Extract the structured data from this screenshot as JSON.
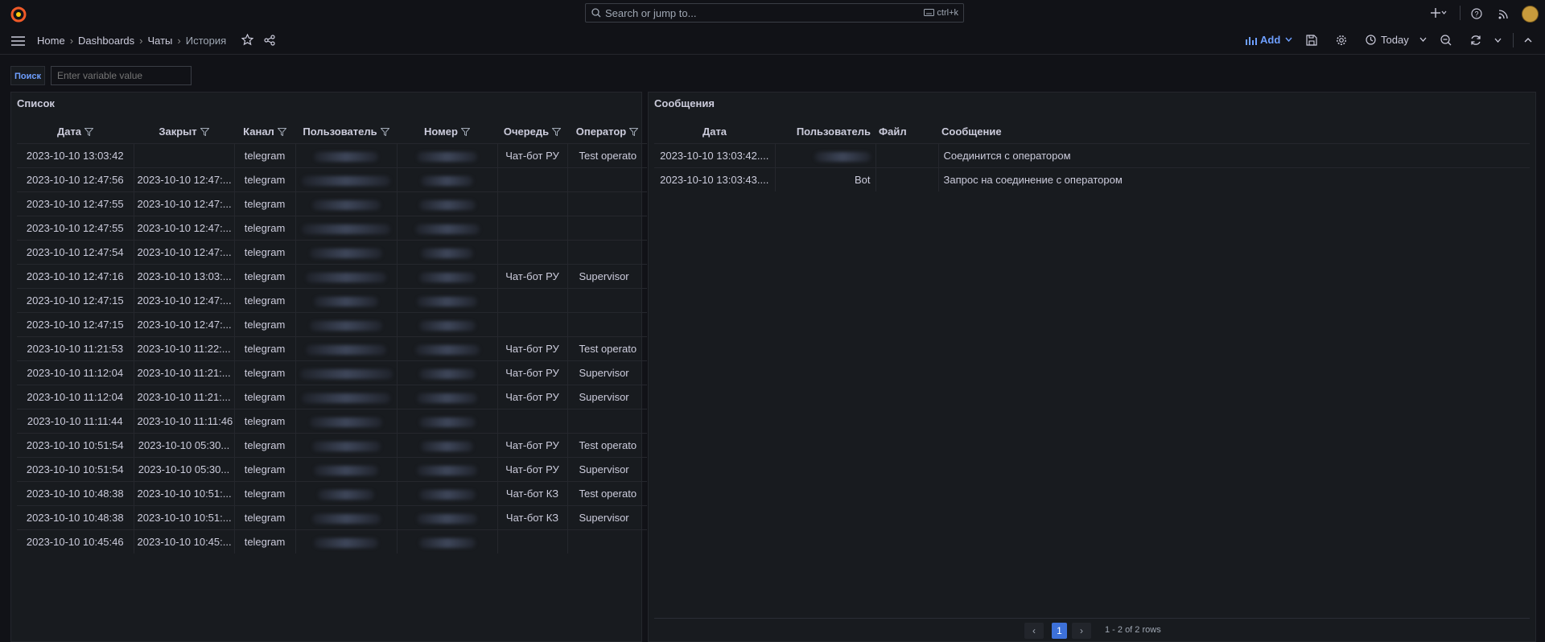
{
  "colors": {
    "accent": "#6e9fff",
    "background": "#111217",
    "panel": "#181b1f",
    "logo": "#f05a28"
  },
  "search": {
    "placeholder": "Search or jump to...",
    "shortcut": "ctrl+k"
  },
  "breadcrumb": {
    "home": "Home",
    "dashboards": "Dashboards",
    "folder": "Чаты",
    "current": "История"
  },
  "toolbar": {
    "add_label": "Add",
    "time_range": "Today"
  },
  "variable": {
    "label": "Поиск",
    "placeholder": "Enter variable value"
  },
  "left_panel": {
    "title": "Список",
    "columns": [
      "Дата",
      "Закрыт",
      "Канал",
      "Пользователь",
      "Номер",
      "Очередь",
      "Оператор"
    ],
    "rows": [
      [
        "2023-10-10 13:03:42",
        "",
        "telegram",
        "",
        "",
        "Чат-бот РУ",
        "Test operato"
      ],
      [
        "2023-10-10 12:47:56",
        "2023-10-10 12:47:...",
        "telegram",
        "",
        "",
        "",
        ""
      ],
      [
        "2023-10-10 12:47:55",
        "2023-10-10 12:47:...",
        "telegram",
        "",
        "",
        "",
        ""
      ],
      [
        "2023-10-10 12:47:55",
        "2023-10-10 12:47:...",
        "telegram",
        "",
        "",
        "",
        ""
      ],
      [
        "2023-10-10 12:47:54",
        "2023-10-10 12:47:...",
        "telegram",
        "",
        "",
        "",
        ""
      ],
      [
        "2023-10-10 12:47:16",
        "2023-10-10 13:03:...",
        "telegram",
        "",
        "",
        "Чат-бот РУ",
        "Supervisor"
      ],
      [
        "2023-10-10 12:47:15",
        "2023-10-10 12:47:...",
        "telegram",
        "",
        "",
        "",
        ""
      ],
      [
        "2023-10-10 12:47:15",
        "2023-10-10 12:47:...",
        "telegram",
        "",
        "",
        "",
        ""
      ],
      [
        "2023-10-10 11:21:53",
        "2023-10-10 11:22:...",
        "telegram",
        "",
        "",
        "Чат-бот РУ",
        "Test operato"
      ],
      [
        "2023-10-10 11:12:04",
        "2023-10-10 11:21:...",
        "telegram",
        "",
        "",
        "Чат-бот РУ",
        "Supervisor"
      ],
      [
        "2023-10-10 11:12:04",
        "2023-10-10 11:21:...",
        "telegram",
        "",
        "",
        "Чат-бот РУ",
        "Supervisor"
      ],
      [
        "2023-10-10 11:11:44",
        "2023-10-10 11:11:46",
        "telegram",
        "",
        "",
        "",
        ""
      ],
      [
        "2023-10-10 10:51:54",
        "2023-10-10 05:30...",
        "telegram",
        "",
        "",
        "Чат-бот РУ",
        "Test operato"
      ],
      [
        "2023-10-10 10:51:54",
        "2023-10-10 05:30...",
        "telegram",
        "",
        "",
        "Чат-бот РУ",
        "Supervisor"
      ],
      [
        "2023-10-10 10:48:38",
        "2023-10-10 10:51:...",
        "telegram",
        "",
        "",
        "Чат-бот КЗ",
        "Test operato"
      ],
      [
        "2023-10-10 10:48:38",
        "2023-10-10 10:51:...",
        "telegram",
        "",
        "",
        "Чат-бот КЗ",
        "Supervisor"
      ],
      [
        "2023-10-10 10:45:46",
        "2023-10-10 10:45:...",
        "telegram",
        "",
        "",
        "",
        ""
      ]
    ]
  },
  "right_panel": {
    "title": "Сообщения",
    "columns": [
      "Дата",
      "Пользователь",
      "Файл",
      "Сообщение"
    ],
    "rows": [
      [
        "2023-10-10 13:03:42....",
        "",
        "",
        "Соединится с оператором"
      ],
      [
        "2023-10-10 13:03:43....",
        "Bot",
        "",
        "Запрос на соединение с оператором"
      ]
    ],
    "pagination": {
      "current_page": "1",
      "summary": "1 - 2 of 2 rows"
    }
  }
}
